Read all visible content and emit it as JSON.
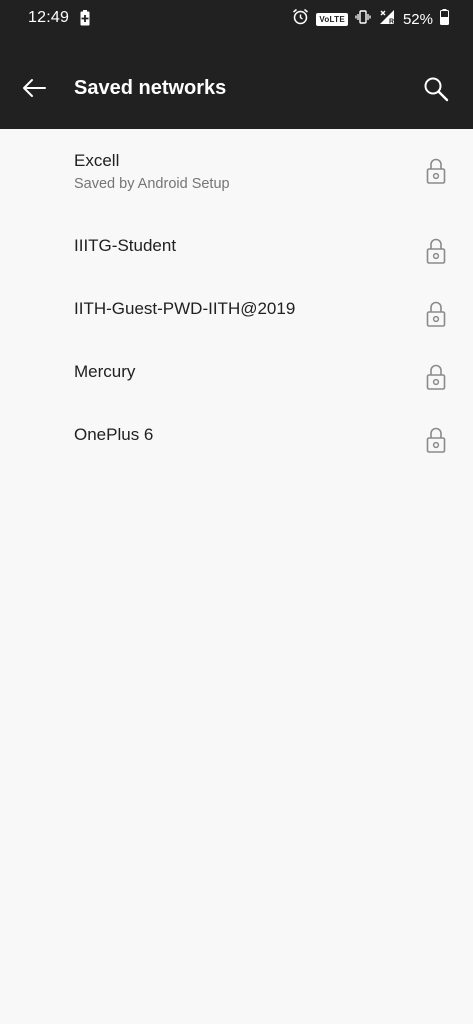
{
  "status_bar": {
    "time": "12:49",
    "volte": "VoLTE",
    "battery_percent": "52%",
    "network_type": "R"
  },
  "app_bar": {
    "title": "Saved networks"
  },
  "networks": [
    {
      "name": "Excell",
      "subtitle": "Saved by Android Setup"
    },
    {
      "name": "IIITG-Student"
    },
    {
      "name": "IITH-Guest-PWD-IITH@2019"
    },
    {
      "name": "Mercury"
    },
    {
      "name": "OnePlus 6"
    }
  ],
  "colors": {
    "app_bar_bg": "#212121",
    "page_bg": "#f8f8f8",
    "primary_text": "#212121",
    "secondary_text": "#757575",
    "icon_gray": "#8a8a8a"
  },
  "icons": {
    "back": "arrow-back-icon",
    "search": "search-icon",
    "lock": "lock-icon"
  }
}
